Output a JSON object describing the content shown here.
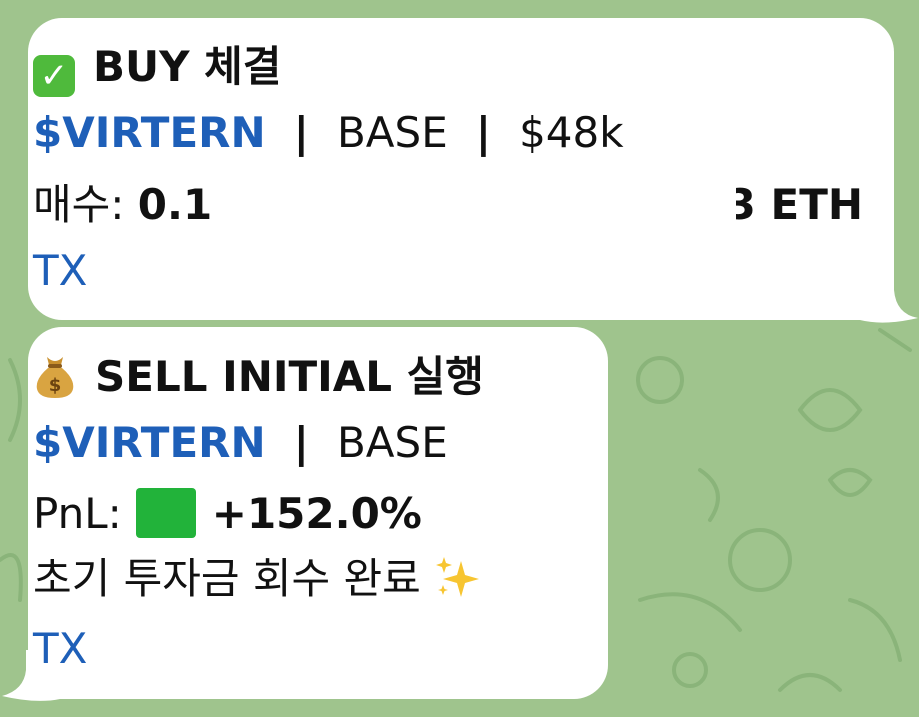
{
  "buy_message": {
    "icon": "check-mark-emoji",
    "title": "BUY 체결",
    "ticker": "$VIRTERN",
    "separator": "|",
    "chain": "BASE",
    "market_cap": "$48k",
    "buy_label": "매수:",
    "buy_amount_start": "0.1",
    "buy_amount_end": "3 ETH",
    "tx_link": "TX"
  },
  "sell_message": {
    "icon": "money-bag-emoji",
    "title": "SELL INITIAL 실행",
    "ticker": "$VIRTERN",
    "separator": "|",
    "chain": "BASE",
    "pnl_label": "PnL:",
    "pnl_indicator_icon": "green-square-emoji",
    "pnl_value": "+152.0%",
    "note": "초기 투자금 회수 완료",
    "note_icon": "sparkles-emoji",
    "tx_link": "TX"
  },
  "colors": {
    "bubble": "#ffffff",
    "link": "#1e5fb8",
    "background": "#9fc48d",
    "pnl_green": "#22b33a"
  }
}
